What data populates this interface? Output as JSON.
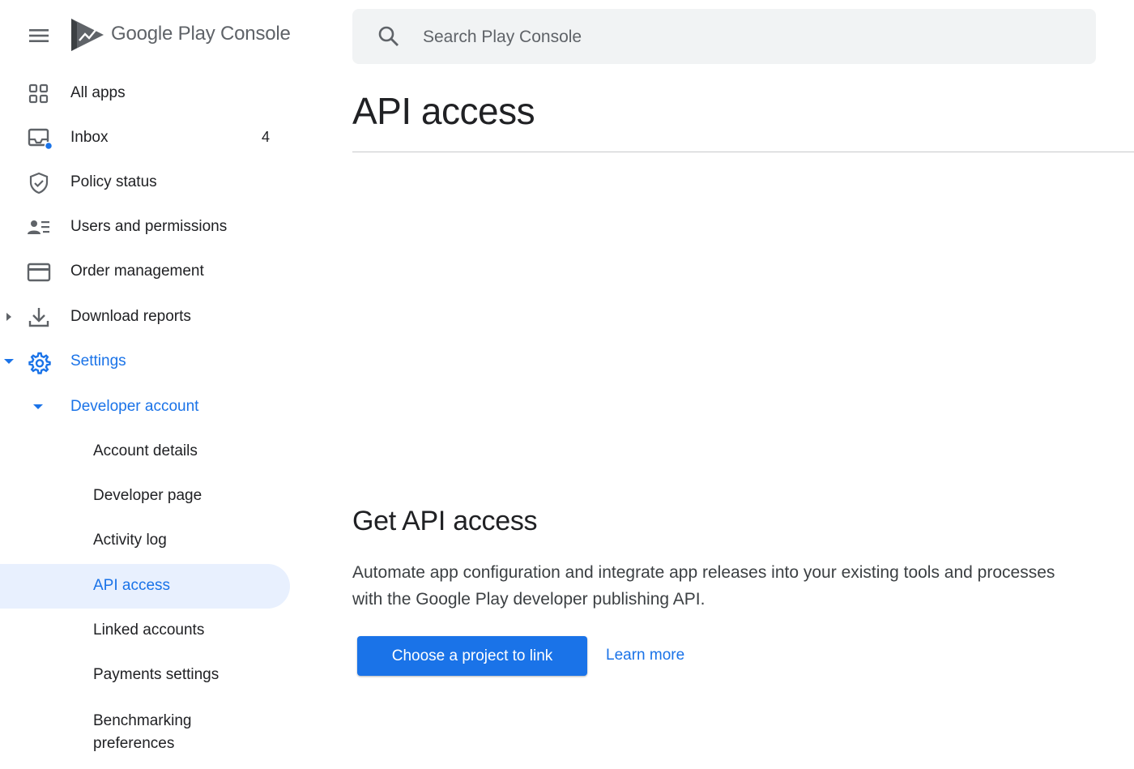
{
  "brand": {
    "google": "Google",
    "play": "Play",
    "console": "Console"
  },
  "search": {
    "placeholder": "Search Play Console"
  },
  "sidebar": {
    "items": [
      {
        "label": "All apps",
        "icon": "grid-icon"
      },
      {
        "label": "Inbox",
        "icon": "inbox-icon",
        "badge": "4"
      },
      {
        "label": "Policy status",
        "icon": "shield-check-icon"
      },
      {
        "label": "Users and permissions",
        "icon": "users-list-icon"
      },
      {
        "label": "Order management",
        "icon": "credit-card-icon"
      },
      {
        "label": "Download reports",
        "icon": "download-icon"
      },
      {
        "label": "Settings",
        "icon": "gear-icon"
      }
    ],
    "developer_account": "Developer account",
    "sub_items": [
      {
        "label": "Account details"
      },
      {
        "label": "Developer page"
      },
      {
        "label": "Activity log"
      },
      {
        "label": "API access"
      },
      {
        "label": "Linked accounts"
      },
      {
        "label": "Payments settings"
      },
      {
        "label": "Benchmarking preferences"
      }
    ]
  },
  "main": {
    "title": "API access",
    "section_title": "Get API access",
    "description": "Automate app configuration and integrate app releases into your existing tools and processes with the Google Play developer publishing API.",
    "primary_button": "Choose a project to link",
    "learn_more": "Learn more"
  },
  "colors": {
    "accent": "#1a73e8",
    "active_bg": "#e8f0fe",
    "notification_dot": "#1a73e8"
  }
}
